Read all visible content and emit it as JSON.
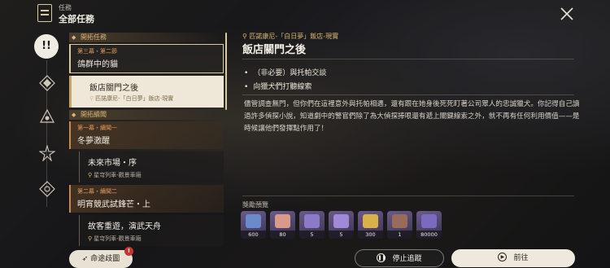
{
  "header": {
    "subtitle": "任務",
    "title": "全部任務"
  },
  "rail": {
    "active_label": "!!",
    "icons": [
      "quest-category-icon",
      "trailblaze-icon",
      "companion-icon",
      "adventure-icon",
      "daily-icon"
    ]
  },
  "quests": {
    "cat1": "開拓任務",
    "q1": {
      "tag": "第三幕・第二節",
      "name": "鴿群中的貓"
    },
    "q2": {
      "name": "飯店關門之後",
      "loc": "匹諾康尼-「白日夢」飯店-現實"
    },
    "cat2": "開拓續聞",
    "q3": {
      "tag": "第一幕・續聞一",
      "name": "冬夢激醒"
    },
    "q4": {
      "name": "未來市場・序",
      "loc": "星穹列車-觀景車廂"
    },
    "q5": {
      "tag": "第二幕・續聞二",
      "name": "明宵競武試鋒芒・上"
    },
    "q6": {
      "name": "故客重遊，演武天舟",
      "loc": "星穹列車-觀景車廂"
    }
  },
  "detail": {
    "location": "匹諾康尼-「白日夢」飯店-現實",
    "title": "飯店關門之後",
    "objectives": [
      "（非必要）與托帕交談",
      "向獵犬們打聽線索"
    ],
    "description": "儘管調查無門，但你們在這裡意外與托帕相遇，還有跟在她身後死死盯著公司眾人的忠誠獵犬。你記得自己讀過許多偵探小說，知道劇中的警官們除了為大偵探捧哏還有遞上關鍵線索之外，就不再有任何利用價值——是時候讓他們發揮點作用了！",
    "rewards_title": "獎勵預覽",
    "rewards": [
      {
        "icon": "stellar-jade-icon",
        "count": "600",
        "color": "#6a8acb"
      },
      {
        "icon": "fuel-icon",
        "count": "80",
        "color": "#d99a8a"
      },
      {
        "icon": "relic-icon",
        "count": "5",
        "color": "#8a7ac8"
      },
      {
        "icon": "relic-icon",
        "count": "5",
        "color": "#a08ad8"
      },
      {
        "icon": "credit-icon",
        "count": "300",
        "color": "#d9b04a"
      },
      {
        "icon": "material-icon",
        "count": "1",
        "color": "#9a6a5a"
      },
      {
        "icon": "exp-book-icon",
        "count": "80000",
        "color": "#7a6ac0"
      }
    ]
  },
  "buttons": {
    "path": "命途歧圖",
    "path_badge": "!",
    "stop": "停止追蹤",
    "go": "前往"
  }
}
